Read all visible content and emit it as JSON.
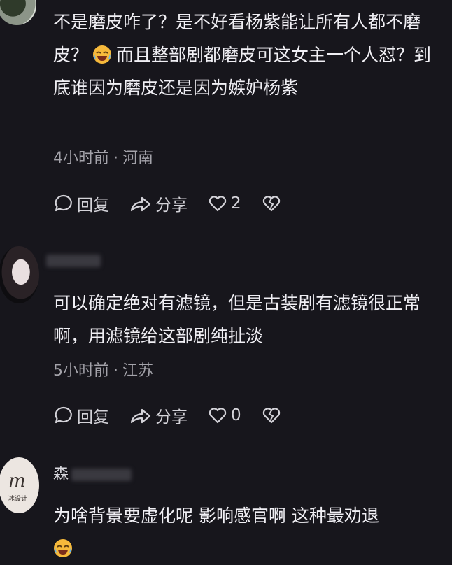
{
  "comments": [
    {
      "username": "",
      "text_before_emoji": "不是磨皮咋了？是不好看杨紫能让所有人都不磨皮？",
      "text_after_emoji": "而且整部剧都磨皮可这女主一个人怼？到底谁因为磨皮还是因为嫉妒杨紫",
      "emoji": "laughing-crying-emoji",
      "time": "4小时前",
      "location": "河南",
      "reply_label": "回复",
      "share_label": "分享",
      "likes": "2"
    },
    {
      "username": "",
      "text_before_emoji": "可以确定绝对有滤镜，但是古装剧有滤镜很正常啊，用滤镜给这部剧纯扯淡",
      "text_after_emoji": "",
      "emoji": "",
      "time": "5小时前",
      "location": "江苏",
      "reply_label": "回复",
      "share_label": "分享",
      "likes": "0"
    },
    {
      "username": "森",
      "text_before_emoji": "为啥背景要虚化呢 影响感官啊  这种最劝退",
      "text_after_emoji": "",
      "emoji": "laughing-crying-emoji",
      "avatar_text": "冰设计"
    }
  ],
  "separator": "·",
  "icons": {
    "reply": "comment-bubble-icon",
    "share": "share-arrow-icon",
    "like": "heart-outline-icon",
    "dislike": "broken-heart-icon"
  },
  "colors": {
    "background": "#17161c",
    "text": "#f0eff4",
    "meta": "#a4a3aa",
    "emoji": "#f6b93b"
  }
}
